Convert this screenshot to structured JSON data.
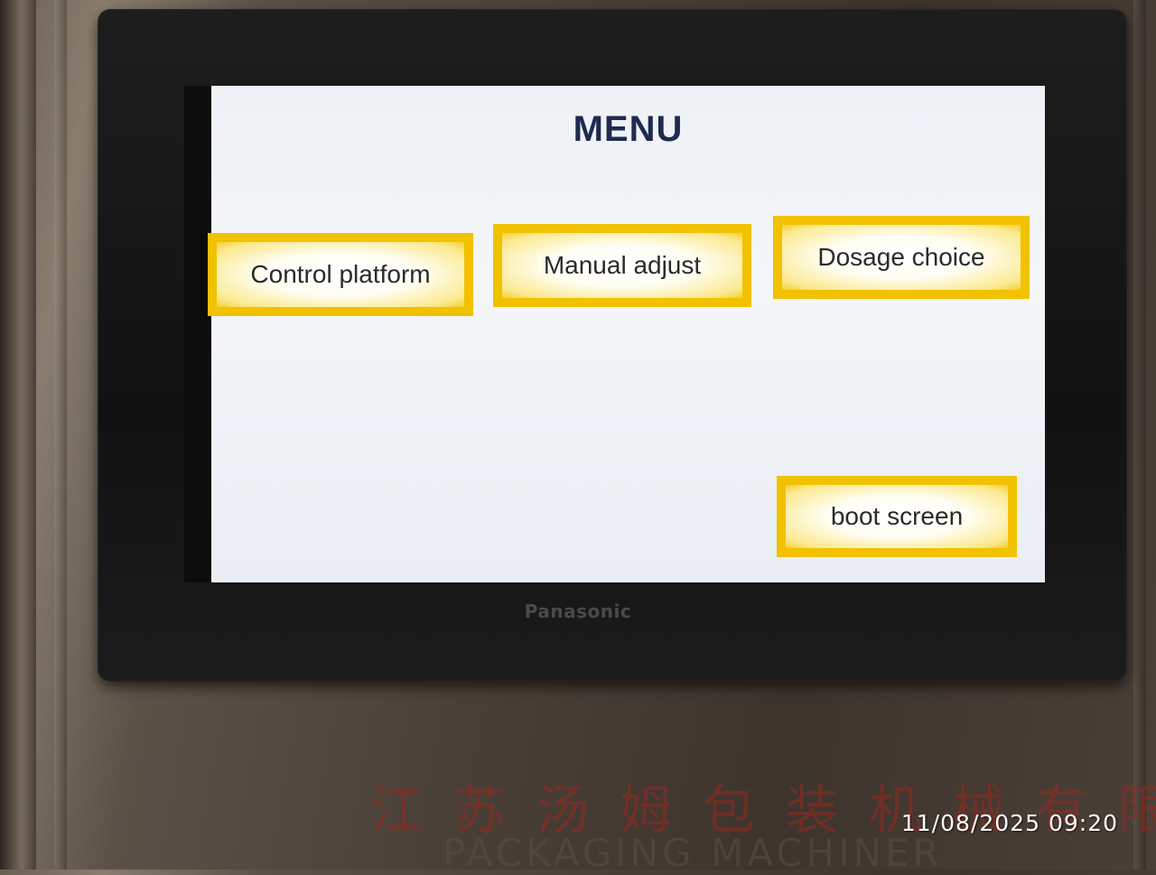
{
  "screen": {
    "title": "MENU",
    "buttons": {
      "control_platform": "Control platform",
      "manual_adjust": "Manual adjust",
      "dosage_choice": "Dosage choice",
      "boot_screen": "boot screen"
    },
    "accent_color": "#f2c100"
  },
  "device": {
    "brand": "Panasonic"
  },
  "nameplate": {
    "chinese": "江苏汤姆包装机械有限",
    "english": "PACKAGING MACHINER"
  },
  "photo": {
    "timestamp": "11/08/2025 09:20"
  }
}
